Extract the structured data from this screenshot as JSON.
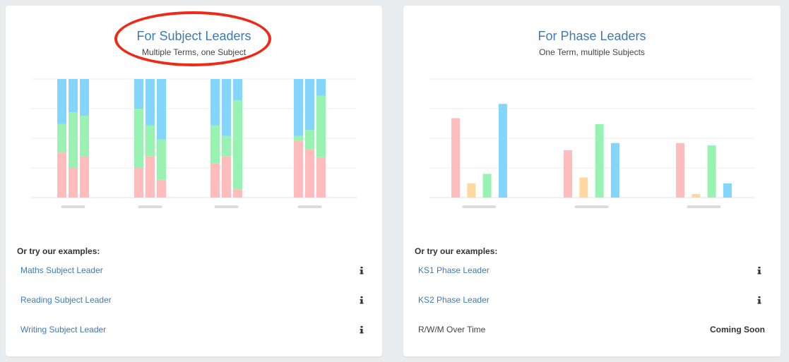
{
  "cards": {
    "subject": {
      "title": "For Subject Leaders",
      "subtitle": "Multiple Terms, one Subject",
      "examples_heading": "Or try our examples:",
      "examples": [
        {
          "label": "Maths Subject Leader",
          "icon": "info-icon"
        },
        {
          "label": "Reading Subject Leader",
          "icon": "info-icon"
        },
        {
          "label": "Writing Subject Leader",
          "icon": "info-icon"
        }
      ]
    },
    "phase": {
      "title": "For Phase Leaders",
      "subtitle": "One Term, multiple Subjects",
      "examples_heading": "Or try our examples:",
      "examples": [
        {
          "label": "KS1 Phase Leader",
          "icon": "info-icon"
        },
        {
          "label": "KS2 Phase Leader",
          "icon": "info-icon"
        },
        {
          "label": "R/W/M Over Time",
          "status": "Coming Soon"
        }
      ]
    }
  },
  "chart_data": [
    {
      "type": "bar",
      "stacked": true,
      "grid": true,
      "ylim": [
        0,
        100
      ],
      "colors": {
        "pink": "#ffbcbc",
        "green": "#9af2b2",
        "blue": "#84d5fb"
      },
      "groups": [
        {
          "bars": [
            [
              38,
              24,
              38
            ],
            [
              25,
              47,
              28
            ],
            [
              35,
              34,
              31
            ]
          ]
        },
        {
          "bars": [
            [
              25,
              50,
              25
            ],
            [
              35,
              26,
              39
            ],
            [
              15,
              34,
              51
            ]
          ]
        },
        {
          "bars": [
            [
              29,
              32,
              39
            ],
            [
              35,
              17,
              48
            ],
            [
              7,
              75,
              18
            ]
          ]
        },
        {
          "bars": [
            [
              48,
              4,
              48
            ],
            [
              41,
              16,
              43
            ],
            [
              34,
              52,
              14
            ]
          ]
        }
      ]
    },
    {
      "type": "bar",
      "grid": true,
      "ylim": [
        0,
        100
      ],
      "colors": [
        "#ffbcbc",
        "#ffd8a0",
        "#9af2b2",
        "#84d5fb"
      ],
      "groups": [
        {
          "values": [
            67,
            12,
            20,
            79
          ]
        },
        {
          "values": [
            40,
            17,
            62,
            46
          ]
        },
        {
          "values": [
            46,
            3,
            44,
            12
          ]
        }
      ]
    }
  ]
}
